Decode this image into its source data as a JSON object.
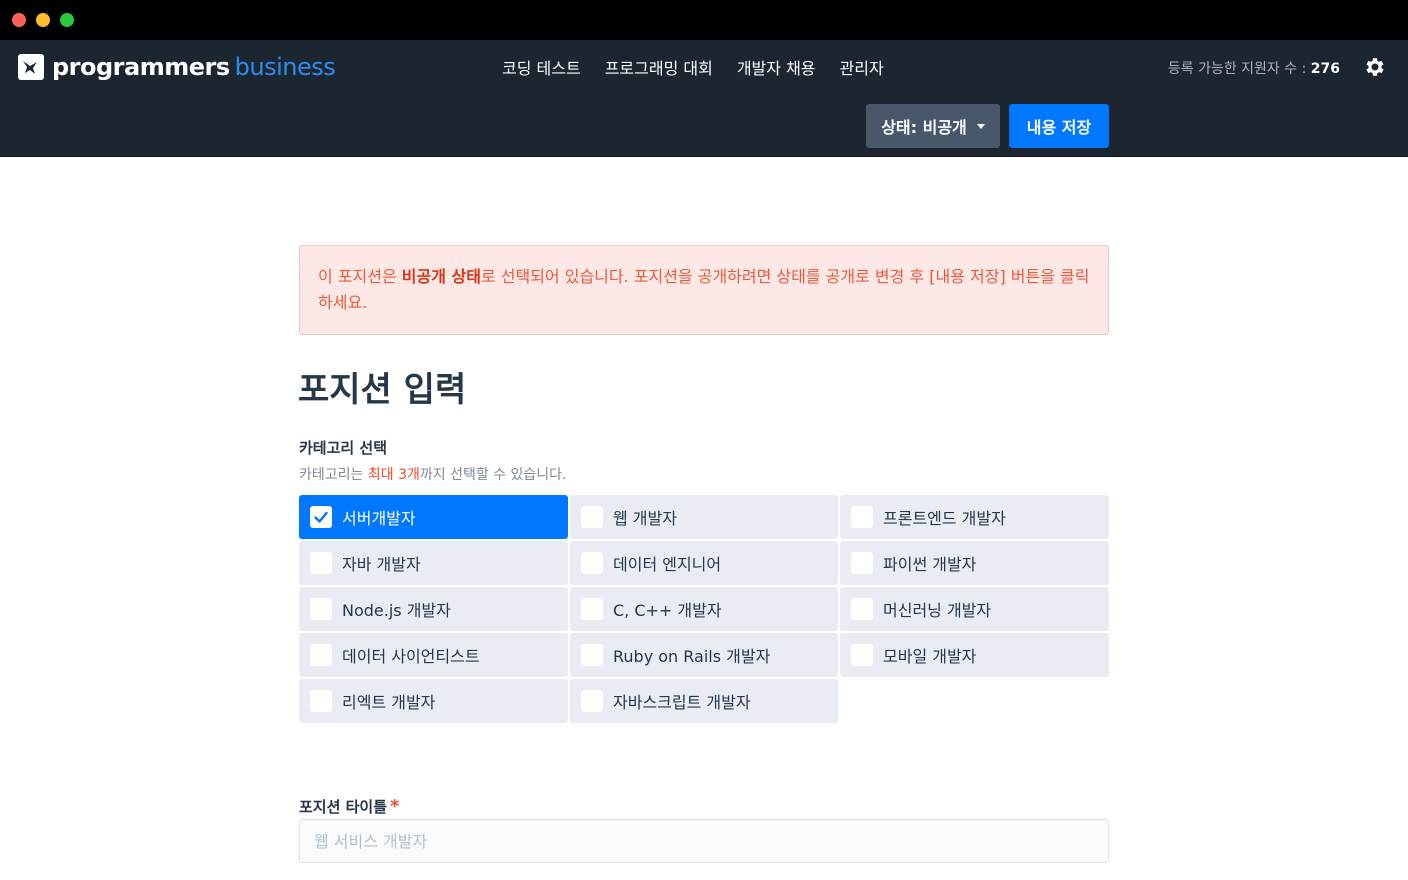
{
  "brand": {
    "name": "programmers",
    "sub": "business"
  },
  "nav": [
    "코딩 테스트",
    "프로그래밍 대회",
    "개발자 채용",
    "관리자"
  ],
  "applicants": {
    "label": "등록 가능한 지원자 수 :",
    "count": "276"
  },
  "actions": {
    "status_label": "상태: 비공개",
    "save_label": "내용 저장"
  },
  "alert": {
    "before": "이 포지션은 ",
    "bold": "비공개 상태",
    "after": "로 선택되어 있습니다. 포지션을 공개하려면 상태를 공개로 변경 후 [내용 저장] 버튼을 클릭하세요."
  },
  "page_title": "포지션 입력",
  "category": {
    "label": "카테고리 선택",
    "help_before": "카테고리는 ",
    "help_em": "최대 3개",
    "help_after": "까지 선택할 수 있습니다.",
    "items": [
      {
        "label": "서버개발자",
        "checked": true
      },
      {
        "label": "웹 개발자",
        "checked": false
      },
      {
        "label": "프론트엔드 개발자",
        "checked": false
      },
      {
        "label": "자바 개발자",
        "checked": false
      },
      {
        "label": "데이터 엔지니어",
        "checked": false
      },
      {
        "label": "파이썬 개발자",
        "checked": false
      },
      {
        "label": "Node.js 개발자",
        "checked": false
      },
      {
        "label": "C, C++ 개발자",
        "checked": false
      },
      {
        "label": "머신러닝 개발자",
        "checked": false
      },
      {
        "label": "데이터 사이언티스트",
        "checked": false
      },
      {
        "label": "Ruby on Rails 개발자",
        "checked": false
      },
      {
        "label": "모바일 개발자",
        "checked": false
      },
      {
        "label": "리엑트 개발자",
        "checked": false
      },
      {
        "label": "자바스크립트 개발자",
        "checked": false
      }
    ]
  },
  "position_title": {
    "label": "포지션 타이틀",
    "required_mark": "*",
    "placeholder": "웹 서비스 개발자",
    "value": ""
  },
  "colors": {
    "header": "#1b2631",
    "primary": "#0077ff",
    "danger": "#f2492a"
  }
}
